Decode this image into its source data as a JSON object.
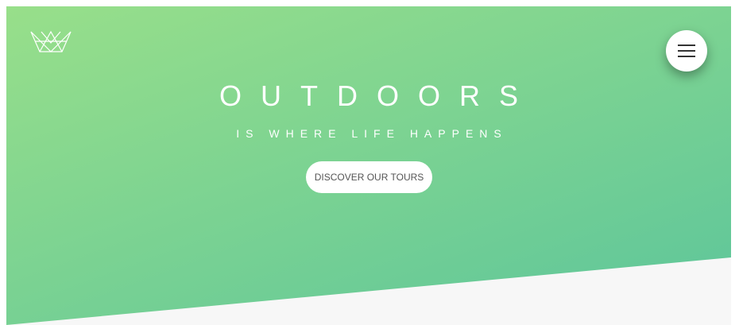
{
  "hero": {
    "title": "OUTDOORS",
    "subtitle": "IS WHERE LIFE HAPPENS",
    "cta_label": "DISCOVER OUR TOURS",
    "gradient_start": "#98df8a",
    "gradient_end": "#5cc59b"
  },
  "header": {
    "logo_icon": "crown-icon",
    "menu_icon": "hamburger-menu-icon"
  },
  "colors": {
    "section_below": "#f7f7f7",
    "button_bg": "#ffffff",
    "button_text": "#555555"
  }
}
